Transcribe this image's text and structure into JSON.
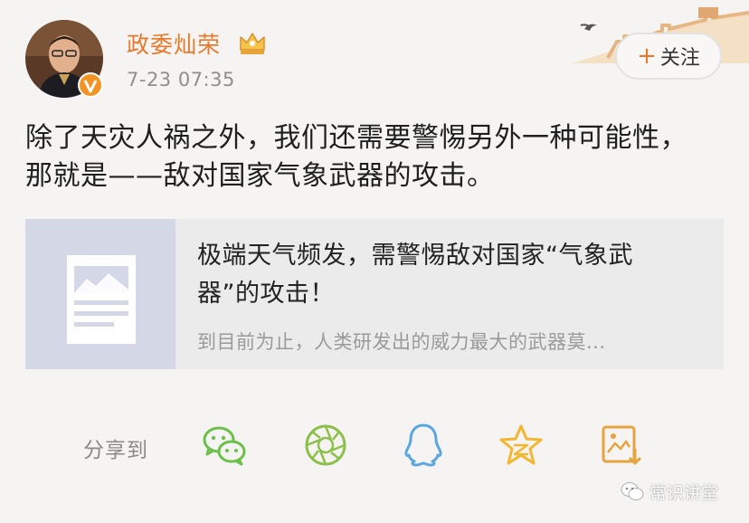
{
  "post": {
    "user_name": "政委灿荣",
    "time": "7-23 07:35",
    "follow_label": "关注",
    "follow_plus": "+",
    "text_line1": "除了天灾人祸之外，我们还需要警惕另外一种可能性，",
    "text_line2": "那就是——敌对国家气象武器的攻击。"
  },
  "link_card": {
    "title_line1": "极端天气频发，需警惕敌对国家“气象武",
    "title_line2": "器”的攻击！",
    "summary": "到目前为止，人类研发出的威力最大的武器莫..."
  },
  "share": {
    "label": "分享到",
    "targets": [
      "wechat-icon",
      "moments-icon",
      "qq-icon",
      "qzone-icon",
      "save-image-icon"
    ]
  },
  "watermark": {
    "text": "常识讲堂"
  },
  "colors": {
    "brand_orange": "#e8792a",
    "text": "#1f1f1f",
    "muted": "#8e8e8e",
    "card_bg": "#ebebeb",
    "share_green": "#6cc04a",
    "share_blue": "#5aa6e0",
    "share_gold": "#f2b632"
  }
}
